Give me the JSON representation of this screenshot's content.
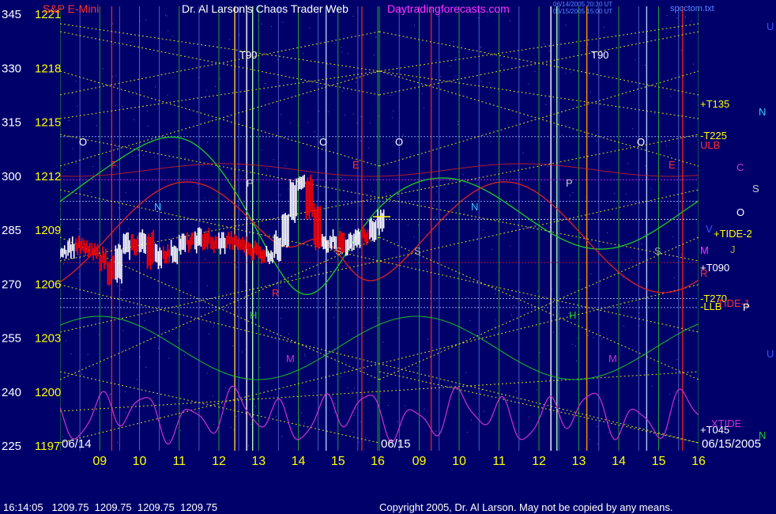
{
  "header": {
    "symbol": "S&P E-Mini",
    "title": "Dr. Al Larson's Chaos Trader Web",
    "site": "Daytradingforecasts.com",
    "stamp1": "06/14/2005 20:30 UT",
    "stamp2": "06/15/2005 15:00 UT",
    "file": "spcctom.txt"
  },
  "footer": {
    "quote": "16:14:05   1209.75  1209.75  1209.75  1209.75",
    "copyright": "Copyright 2005, Dr. Al Larson. May not be copied by any means."
  },
  "colors": {
    "background": "#00006b",
    "price_bar": "#ffffff",
    "down_bar": "#ff0000",
    "grid_hour": "#22c822",
    "grid_line": "#88aaff",
    "yellow": "#ffff00",
    "green_flux": "#22cc22",
    "red_flux": "#dd2222",
    "xtide": "#cc33cc",
    "cyan": "#aaccff"
  },
  "chart_data": {
    "type": "line",
    "title": "Dr. Al Larson's Chaos Trader Web",
    "left_axis_labels": [
      "345",
      "330",
      "315",
      "300",
      "285",
      "270",
      "255",
      "240",
      "225"
    ],
    "right_axis_labels": [
      "1221",
      "1218",
      "1215",
      "1212",
      "1209",
      "1206",
      "1203",
      "1200",
      "1197"
    ],
    "price_range": [
      1197,
      1221
    ],
    "date_labels": [
      "06/14",
      "06/15",
      "06/15/2005"
    ],
    "hour_ticks": [
      "09",
      "10",
      "11",
      "12",
      "13",
      "14",
      "15",
      "16",
      "09",
      "10",
      "11",
      "12",
      "13",
      "14",
      "15",
      "16"
    ],
    "series": [
      {
        "name": "S&P E-Mini",
        "x_hours": [
          8.0,
          8.2,
          8.4,
          8.6,
          8.8,
          9.0,
          9.2,
          9.4,
          9.6,
          9.8,
          10.0,
          10.2,
          10.4,
          10.6,
          10.8,
          11.0,
          11.2,
          11.4,
          11.6,
          11.8,
          12.0,
          12.2,
          12.4,
          12.6,
          12.8,
          13.0,
          13.2,
          13.4,
          13.6,
          13.8,
          14.0,
          14.2,
          14.4,
          14.6,
          14.8,
          15.0,
          15.2,
          15.4,
          15.6,
          15.8,
          16.0
        ],
        "values": [
          1207.9,
          1208.2,
          1208.0,
          1207.8,
          1207.6,
          1207.2,
          1206.4,
          1207.8,
          1208.4,
          1208.0,
          1208.6,
          1207.3,
          1207.8,
          1207.6,
          1208.0,
          1208.4,
          1208.2,
          1208.7,
          1208.3,
          1208.1,
          1208.5,
          1208.3,
          1208.2,
          1208.0,
          1207.8,
          1207.6,
          1207.7,
          1208.5,
          1209.8,
          1211.4,
          1211.6,
          1210.0,
          1208.2,
          1208.4,
          1208.6,
          1208.0,
          1208.4,
          1208.8,
          1208.6,
          1209.2,
          1209.75
        ]
      }
    ],
    "line_labels": [
      "T90",
      "T90",
      "+T135",
      "-T225",
      "ULB",
      "+TIDE-2",
      "+T090",
      "-T270",
      "-LLB",
      "TIDE-1",
      "+T045",
      "XTIDE"
    ],
    "planet_labels": [
      "U",
      "N",
      "C",
      "S",
      "O",
      "V",
      "M",
      "J",
      "R",
      "P",
      "U",
      "N"
    ],
    "curve_markers": [
      "O",
      "N",
      "P",
      "R",
      "H",
      "M",
      "O",
      "S",
      "E",
      "O",
      "N",
      "S",
      "P",
      "O",
      "E",
      "S",
      "H",
      "M",
      "F"
    ]
  }
}
